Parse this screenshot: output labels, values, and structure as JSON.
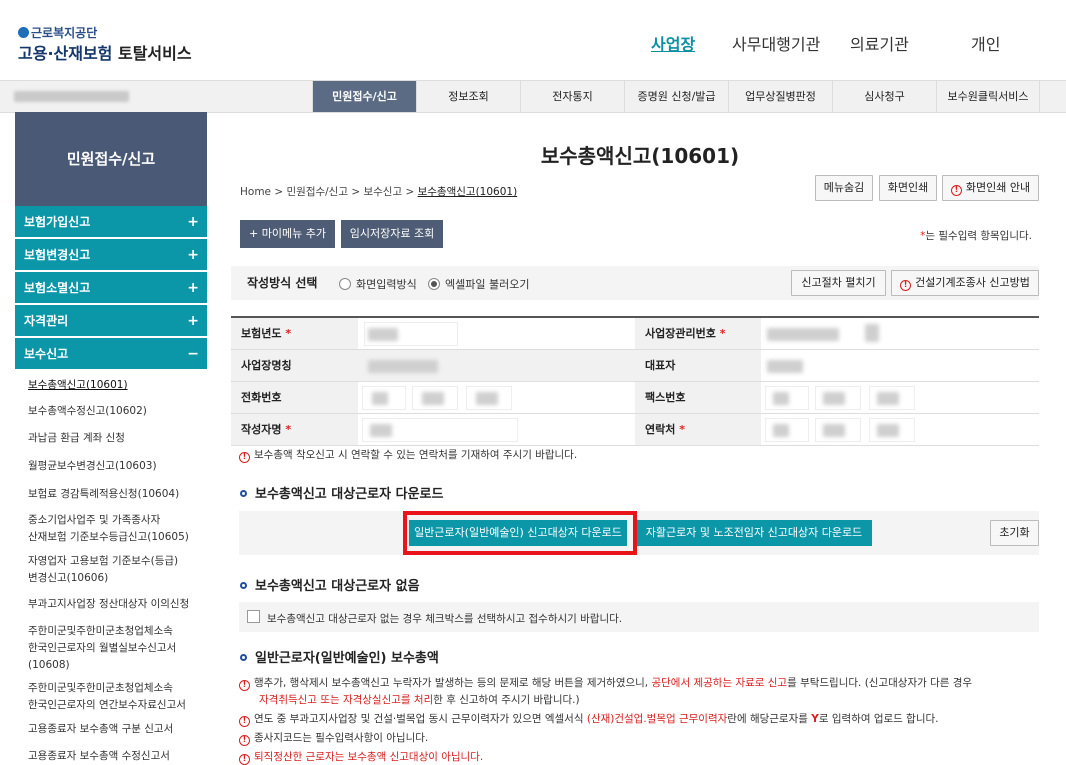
{
  "header": {
    "logo_sub": "근로복지공단",
    "logo_main_a": "고용·산재보험",
    "logo_main_b": "토탈서비스",
    "nav": [
      {
        "label": "사업장",
        "active": true
      },
      {
        "label": "사무대행기관",
        "active": false
      },
      {
        "label": "의료기관",
        "active": false
      },
      {
        "label": "개인",
        "active": false
      }
    ]
  },
  "gnb": [
    "민원접수/신고",
    "정보조회",
    "전자통지",
    "증명원 신청/발급",
    "업무상질병판정",
    "심사청구",
    "보수원클릭서비스"
  ],
  "sidebar": {
    "title": "민원접수/신고",
    "groups": [
      {
        "label": "보험가입신고",
        "sign": "+"
      },
      {
        "label": "보험변경신고",
        "sign": "+"
      },
      {
        "label": "보험소멸신고",
        "sign": "+"
      },
      {
        "label": "자격관리",
        "sign": "+"
      },
      {
        "label": "보수신고",
        "sign": "−"
      }
    ],
    "items": [
      "보수총액신고(10601)",
      "보수총액수정신고(10602)",
      "과납금 환급 계좌 신청",
      "월평균보수변경신고(10603)",
      "보험료 경감특례적용신청(10604)",
      "중소기업사업주 및 가족종사자\n산재보험 기준보수등급신고(10605)",
      "자영업자 고용보험 기준보수(등급)\n변경신고(10606)",
      "부과고지사업장 정산대상자 이의신청",
      "주한미군및주한미군초청업체소속\n한국인근로자의 월별실보수신고서\n(10608)",
      "주한미군및주한미군초청업체소속\n한국인근로자의 연간보수자료신고서",
      "고용종료자 보수총액 구분 신고서",
      "고용종료자 보수총액 수정신고서"
    ]
  },
  "page": {
    "title": "보수총액신고(10601)",
    "breadcrumb": [
      "Home",
      "민원접수/신고",
      "보수신고",
      "보수총액신고(10601)"
    ],
    "btn_menu_hide": "메뉴숨김",
    "btn_print": "화면인쇄",
    "btn_print_guide": "화면인쇄 안내",
    "btn_add_mymenu": "+ 마이메뉴 추가",
    "btn_temp_save": "임시저장자료 조회",
    "required_note_star": "*",
    "required_note": "는 필수입력 항목입니다.",
    "method_label": "작성방식 선택",
    "method_options": [
      "화면입력방식",
      "엑셀파일 불러오기"
    ],
    "method_selected": 1,
    "btn_procedure": "신고절차 펼치기",
    "btn_construction": "건설기계조종사 신고방법"
  },
  "form": {
    "insurance_year": "보험년도",
    "biz_no": "사업장관리번호",
    "biz_name": "사업장명칭",
    "representative": "대표자",
    "phone": "전화번호",
    "fax": "팩스번호",
    "writer": "작성자명",
    "contact": "연락처",
    "star": "*",
    "notice": "보수총액 착오신고 시 연락할 수 있는 연락처를 기재하여 주시기 바랍니다."
  },
  "download": {
    "section_title": "보수총액신고 대상근로자 다운로드",
    "btn_general": "일반근로자(일반예술인) 신고대상자 다운로드",
    "btn_daily": "자활근로자 및 노조전임자 신고대상자 다운로드",
    "btn_reset": "초기화"
  },
  "no_workers": {
    "section_title": "보수총액신고 대상근로자 없음",
    "checkbox_label": "보수총액신고 대상근로자 없는 경우 체크박스를 선택하시고 접수하시기 바랍니다."
  },
  "general": {
    "section_title": "일반근로자(일반예술인) 보수총액",
    "n1_a": "행추가, 행삭제시 보수총액신고 누락자가 발생하는 등의 문제로 해당 버튼을 제거하였으니, ",
    "n1_b": "공단에서 제공하는 자료로 신고",
    "n1_c": "를 부탁드립니다. (신고대상자가 다른 경우",
    "n1_d": "자격취득신고 또는 자격상실신고를 처리",
    "n1_e": "한 후 신고하여 주시기 바랍니다.)",
    "n2_a": "연도 중 부과고지사업장 및 건설·벌목업 동시 근무이력자가 있으면 엑셀서식 ",
    "n2_b": "(산재)건설업.벌목업 근무이력자",
    "n2_c": "란에 해당근로자를 ",
    "n2_d": "Y",
    "n2_e": "로 입력하여 업로드 합니다.",
    "n3": "종사지코드는 필수입력사항이 아닙니다.",
    "n4": "퇴직정산한 근로자는 보수총액 신고대상이 아닙니다."
  },
  "colors": {
    "teal": "#0c97a9",
    "navy": "#4a5975",
    "highlight": "#e8141a",
    "warning": "#d82020"
  }
}
